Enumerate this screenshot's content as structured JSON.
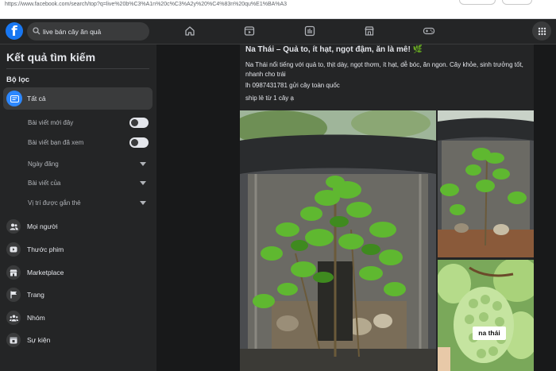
{
  "search": {
    "value": "live bán cây ăn quả"
  },
  "browser": {
    "url_text": "https://www.facebook.com/search/top?q=live%20b%C3%A1n%20c%C3%A2y%20%C4%83n%20qu%E1%BA%A3"
  },
  "nav": {
    "icons": [
      "home-icon",
      "video-icon",
      "feed-icon",
      "marketplace-icon",
      "gaming-icon",
      "menu-grid-icon"
    ]
  },
  "sidebar": {
    "title": "Kết quả tìm kiếm",
    "filter_label": "Bộ lọc",
    "all_label": "Tất cả",
    "toggles": [
      {
        "label": "Bài viết mới đây",
        "on": false
      },
      {
        "label": "Bài viết bạn đã xem",
        "on": false
      }
    ],
    "dropdowns": [
      {
        "label": "Ngày đăng"
      },
      {
        "label": "Bài viết của"
      },
      {
        "label": "Vị trí được gắn thẻ"
      }
    ],
    "items": [
      {
        "label": "Mọi người",
        "icon": "people-icon"
      },
      {
        "label": "Thước phim",
        "icon": "reels-icon"
      },
      {
        "label": "Marketplace",
        "icon": "marketplace-icon"
      },
      {
        "label": "Trang",
        "icon": "flag-icon"
      },
      {
        "label": "Nhóm",
        "icon": "groups-icon"
      },
      {
        "label": "Sự kiện",
        "icon": "calendar-icon"
      }
    ]
  },
  "post": {
    "title": "Na Thái – Quả to, ít hạt, ngọt đậm, ăn là mê! 🌿",
    "body": "Na Thái nổi tiếng với quả to, thịt dày, ngọt thơm, ít hạt, dễ bóc, ăn ngon. Cây khỏe, sinh trưởng tốt, nhanh cho trái",
    "phone_line": "lh 0987431781 gửi cây toàn quốc",
    "ship_line": "ship lẻ từ 1 cây ạ",
    "image_label": "na thái"
  },
  "colors": {
    "background": "#18191a",
    "surface": "#242526",
    "accent": "#1877f2",
    "text": "#e4e6eb"
  }
}
